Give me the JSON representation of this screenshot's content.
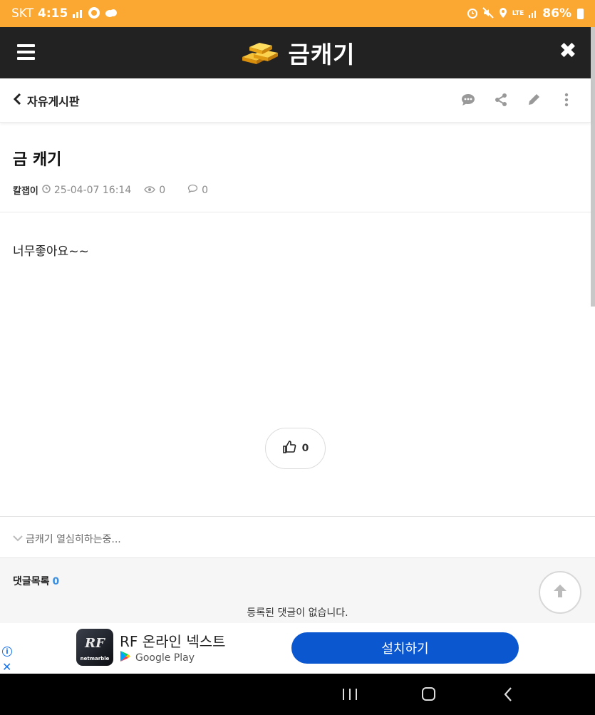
{
  "status_bar": {
    "carrier": "SKT",
    "time": "4:15",
    "battery": "86%",
    "network": "LTE",
    "icons": [
      "signal-chart-icon",
      "messenger-icon",
      "cloud-icon",
      "alarm-icon",
      "mute-icon",
      "location-icon",
      "lte-icon",
      "cell-signal-icon",
      "battery-icon"
    ]
  },
  "header": {
    "title": "금캐기",
    "menu_icon": "hamburger-icon",
    "logo_icon": "gold-bars-icon",
    "close_icon": "close-icon",
    "colors": {
      "status_bar": "#fba833",
      "header": "#222222"
    }
  },
  "board": {
    "name": "자유게시판",
    "tools": [
      "comment-icon",
      "share-icon",
      "edit-icon",
      "more-icon"
    ]
  },
  "post": {
    "title": "금 캐기",
    "author": "칼잽이",
    "datetime": "25-04-07 16:14",
    "views": "0",
    "comments": "0",
    "body": "너무좋아요~~",
    "likes": "0",
    "signature": "금캐기 열심히하는중..."
  },
  "comments": {
    "heading": "댓글목록",
    "count": "0",
    "empty_text": "등록된 댓글이 없습니다."
  },
  "ad": {
    "title": "RF 온라인 넥스트",
    "store": "Google Play",
    "button": "설치하기",
    "icon_text": "RF",
    "icon_subtext": "netmarble",
    "accent": "#0b57d0"
  }
}
